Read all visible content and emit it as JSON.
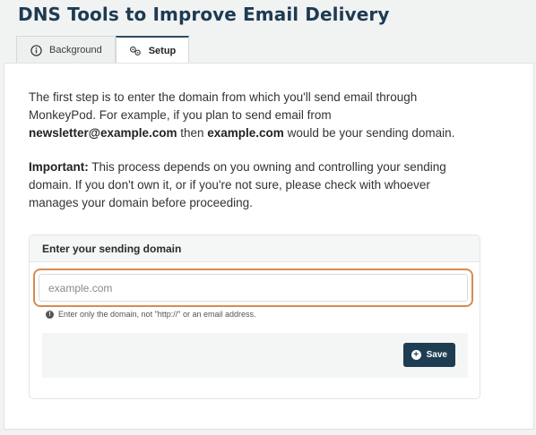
{
  "page": {
    "title": "DNS Tools to Improve Email Delivery"
  },
  "tabs": [
    {
      "label": "Background",
      "icon": "info-icon"
    },
    {
      "label": "Setup",
      "icon": "gears-icon",
      "active": true
    }
  ],
  "intro": {
    "p1_a": "The first step is to enter the domain from which you'll send email through MonkeyPod. For example, if you plan to send email from ",
    "p1_email": "newsletter@example.com",
    "p1_b": " then ",
    "p1_domain": "example.com",
    "p1_c": " would be your sending domain.",
    "p2_label": "Important:",
    "p2_text": " This process depends on you owning and controlling your sending domain. If you don't own it, or if you're not sure, please check with whoever manages your domain before proceeding."
  },
  "card": {
    "header": "Enter your sending domain",
    "input_placeholder": "example.com",
    "input_value": "",
    "hint": "Enter only the domain, not \"http://\" or an email address.",
    "save_label": "Save"
  },
  "colors": {
    "title": "#1d3b52",
    "focus_ring": "#d98a4e",
    "save_button": "#1f3d52"
  }
}
